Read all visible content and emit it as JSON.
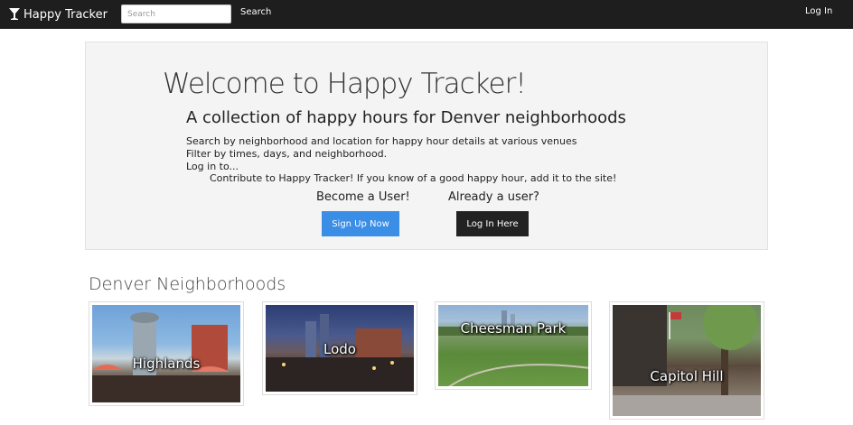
{
  "navbar": {
    "brand": "Happy Tracker",
    "search_placeholder": "Search",
    "search_button": "Search",
    "login_link": "Log In"
  },
  "jumbotron": {
    "title": "Welcome to Happy Tracker!",
    "subtitle": "A collection of happy hours for Denver neighborhoods",
    "lines": [
      "Search by neighborhood and location for happy hour details at various venues",
      "Filter by times, days, and neighborhood.",
      "Log in to...",
      "Contribute to Happy Tracker! If you know of a good happy hour, add it to the site!"
    ],
    "become_user": "Become a User!",
    "already_user": "Already a user?",
    "signup_button": "Sign Up Now",
    "login_button": "Log In Here"
  },
  "neighborhoods": {
    "title": "Denver Neighborhoods",
    "items": [
      {
        "label": "Highlands"
      },
      {
        "label": "Lodo"
      },
      {
        "label": "Cheesman Park"
      },
      {
        "label": "Capitol Hill"
      }
    ]
  },
  "colors": {
    "navbar_bg": "#1e1e1e",
    "signup_button": "#3a8ee6",
    "login_button": "#222222",
    "jumbotron_bg": "#f4f4f4"
  }
}
